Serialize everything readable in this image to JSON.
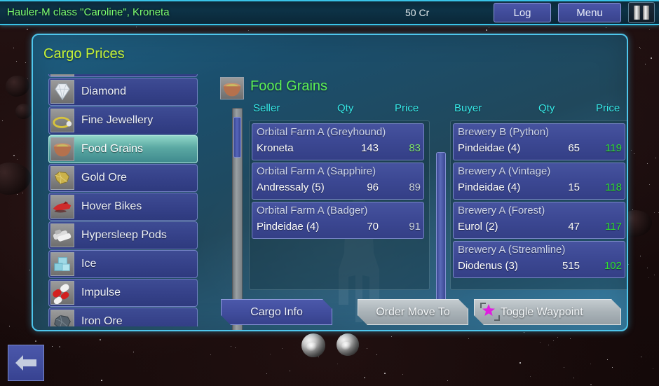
{
  "topbar": {
    "ship_title": "Hauler-M class \"Caroline\", Kroneta",
    "credits": "50 Cr",
    "log_label": "Log",
    "menu_label": "Menu",
    "pause_icon": "pause-icon"
  },
  "panel": {
    "title": "Cargo Prices"
  },
  "cargo_list": {
    "items": [
      {
        "label": "",
        "icon": "partial-row-icon",
        "selected": false,
        "partial": true
      },
      {
        "label": "Diamond",
        "icon": "diamond-icon",
        "selected": false
      },
      {
        "label": "Fine Jewellery",
        "icon": "ring-icon",
        "selected": false
      },
      {
        "label": "Food Grains",
        "icon": "grain-bowl-icon",
        "selected": true
      },
      {
        "label": "Gold Ore",
        "icon": "gold-nugget-icon",
        "selected": false
      },
      {
        "label": "Hover Bikes",
        "icon": "hover-bike-icon",
        "selected": false
      },
      {
        "label": "Hypersleep Pods",
        "icon": "sleep-pod-icon",
        "selected": false
      },
      {
        "label": "Ice",
        "icon": "ice-cube-icon",
        "selected": false
      },
      {
        "label": "Impulse",
        "icon": "capsule-icon",
        "selected": false
      },
      {
        "label": "Iron Ore",
        "icon": "iron-rock-icon",
        "selected": false
      }
    ]
  },
  "detail": {
    "commodity": "Food Grains",
    "icon": "grain-bowl-icon"
  },
  "seller_table": {
    "headers": {
      "name": "Seller",
      "qty": "Qty",
      "price": "Price"
    },
    "rows": [
      {
        "name": "Orbital Farm A (Greyhound)",
        "location": "Kroneta",
        "qty": "143",
        "price": "83",
        "price_color": "#7de36c"
      },
      {
        "name": "Orbital Farm A (Sapphire)",
        "location": "Andressaly (5)",
        "qty": "96",
        "price": "89",
        "price_color": "#c9d2dd"
      },
      {
        "name": "Orbital Farm A (Badger)",
        "location": "Pindeidae (4)",
        "qty": "70",
        "price": "91",
        "price_color": "#c9d2dd"
      }
    ]
  },
  "buyer_table": {
    "headers": {
      "name": "Buyer",
      "qty": "Qty",
      "price": "Price"
    },
    "rows": [
      {
        "name": "Brewery B (Python)",
        "location": "Pindeidae (4)",
        "qty": "65",
        "price": "119",
        "price_color": "#2ee02e"
      },
      {
        "name": "Brewery A (Vintage)",
        "location": "Pindeidae (4)",
        "qty": "15",
        "price": "118",
        "price_color": "#2ee02e"
      },
      {
        "name": "Brewery A (Forest)",
        "location": "Eurol (2)",
        "qty": "47",
        "price": "117",
        "price_color": "#2ee02e"
      },
      {
        "name": "Brewery A (Streamline)",
        "location": "Diodenus (3)",
        "qty": "515",
        "price": "102",
        "price_color": "#2ee02e"
      }
    ]
  },
  "actions": {
    "cargo_info": "Cargo Info",
    "order_move_to": "Order Move To",
    "toggle_waypoint": "Toggle Waypoint",
    "waypoint_icon": "waypoint-star-icon"
  },
  "back": {
    "icon": "back-arrow-icon"
  },
  "colors": {
    "accent_cyan": "#36e8e8",
    "title_yellow_green": "#c5f238",
    "commodity_green": "#5cf055",
    "ship_title_green": "#7dff70",
    "row_blue": "#3c4893",
    "selected_teal": "#5aa8a2"
  }
}
